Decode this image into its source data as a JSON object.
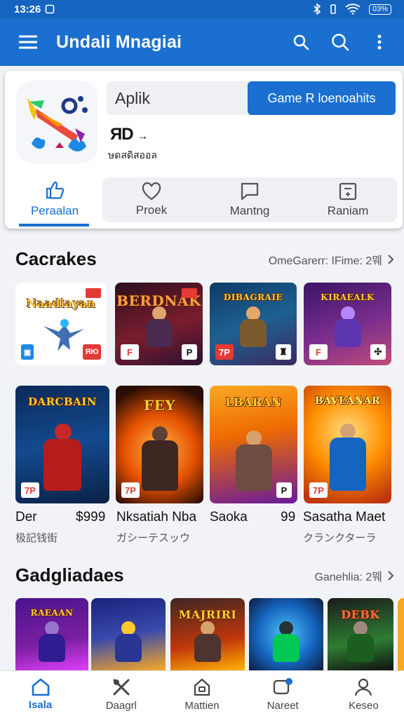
{
  "status_bar": {
    "time": "13:26",
    "battery": "03%"
  },
  "app_bar": {
    "title": "Undali Mnagiai"
  },
  "header": {
    "search_value": "Aplik",
    "search_button": "Game R loenoahits",
    "app_badge": "ЯD",
    "app_badge_arrow": "→",
    "app_subtitle": "ษดสดิสออล",
    "tabs": [
      {
        "label": "Peraalan",
        "icon": "thumbs-up-icon",
        "active": true
      },
      {
        "label": "Proek",
        "icon": "heart-icon",
        "active": false
      },
      {
        "label": "Mantng",
        "icon": "chat-icon",
        "active": false
      },
      {
        "label": "Raniam",
        "icon": "calculator-icon",
        "active": false
      }
    ]
  },
  "section1": {
    "title": "Cacrakes",
    "link": "OmeGarerr: IFime: 2뭬",
    "row1": [
      {
        "name": "Naadiayan",
        "tag_left": "",
        "tag_right": "ЯЮ"
      },
      {
        "name": "BERDNAK",
        "tag_left": "F",
        "tag_right": "P"
      },
      {
        "name": "DIBAGRAIE",
        "tag_left": "7P",
        "tag_right": "♜"
      },
      {
        "name": "KIRAEALK",
        "tag_left": "F",
        "tag_right": "✣"
      }
    ],
    "row2": [
      {
        "name": "DARCBAIN",
        "tag_left": "7P",
        "tag_right": ""
      },
      {
        "name": "FEY",
        "tag_left": "7P",
        "tag_right": ""
      },
      {
        "name": "LBARAN",
        "tag_left": "",
        "tag_right": "P"
      },
      {
        "name": "BAVEANAR",
        "tag_left": "7P",
        "tag_right": ""
      }
    ],
    "captions": [
      {
        "title": "Der",
        "price": "$999",
        "sub": "极記钱街"
      },
      {
        "title": "Nksatiah Nba",
        "price": "",
        "sub": "ガシーテスッウ"
      },
      {
        "title": "Saoka",
        "price": "99",
        "sub": ""
      },
      {
        "title": "Sasatha Maet",
        "price": "",
        "sub": "クランクターラ"
      }
    ]
  },
  "section2": {
    "title": "Gadgliadaes",
    "link": "Ganehlia: 2뭬",
    "tiles": [
      {
        "name": "RAEAAN"
      },
      {
        "name": ""
      },
      {
        "name": "MAJRIRI"
      },
      {
        "name": ""
      },
      {
        "name": "DEBK"
      }
    ]
  },
  "bottom_nav": [
    {
      "label": "Isala",
      "icon": "home-icon",
      "active": true
    },
    {
      "label": "Daagrl",
      "icon": "tools-icon",
      "active": false
    },
    {
      "label": "Mattien",
      "icon": "store-icon",
      "active": false
    },
    {
      "label": "Nareet",
      "icon": "notification-icon",
      "active": false
    },
    {
      "label": "Keseo",
      "icon": "profile-icon",
      "active": false
    }
  ],
  "colors": {
    "primary": "#1a6fd0",
    "status_bar": "#1565c0",
    "badge_red": "#e53935"
  }
}
